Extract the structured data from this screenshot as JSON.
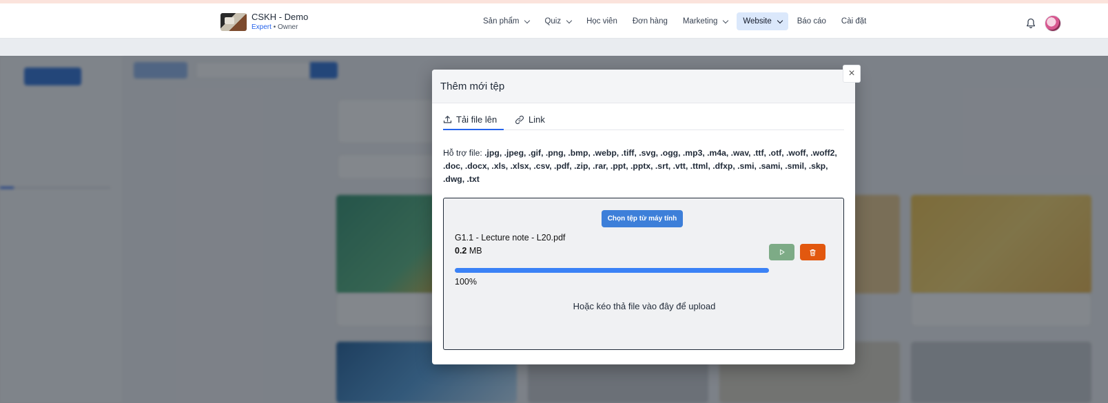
{
  "header": {
    "brand_name": "CSKH - Demo",
    "brand_level": "Expert",
    "brand_sep": "•",
    "brand_role": "Owner",
    "nav": [
      {
        "label": "Sản phẩm"
      },
      {
        "label": "Quiz"
      },
      {
        "label": "Học viên"
      },
      {
        "label": "Đơn hàng"
      },
      {
        "label": "Marketing"
      },
      {
        "label": "Website"
      },
      {
        "label": "Báo cáo"
      },
      {
        "label": "Cài đặt"
      }
    ],
    "active_nav": "Website"
  },
  "modal": {
    "title": "Thêm mới tệp",
    "close_glyph": "×",
    "tabs": {
      "upload": "Tải file lên",
      "link": "Link"
    },
    "support_label": "Hỗ trợ file:",
    "support_types": ".jpg, .jpeg, .gif, .png, .bmp, .webp, .tiff, .svg, .ogg, .mp3, .m4a, .wav, .ttf, .otf, .woff, .woff2, .doc, .docx, .xls, .xlsx, .csv, .pdf, .zip, .rar, .ppt, .pptx, .srt, .vtt, .ttml, .dfxp, .smi, .sami, .smil, .skp, .dwg, .txt",
    "choose_button": "Chọn tệp từ máy tính",
    "file": {
      "name": "G1.1 - Lecture note - L20.pdf",
      "size_value": "0.2",
      "size_unit": "MB",
      "progress_percent": 100,
      "progress_text": "100%"
    },
    "drop_hint": "Hoặc kéo thả file vào đây để upload"
  },
  "colors": {
    "accent": "#2563eb",
    "button_blue": "#3d7fd9",
    "play_green": "#7dab86",
    "delete_orange": "#e2580f"
  }
}
